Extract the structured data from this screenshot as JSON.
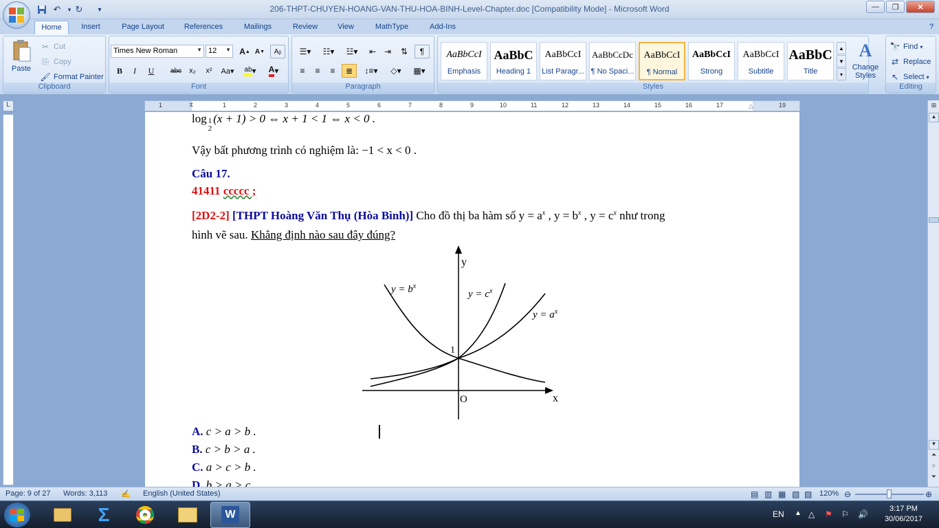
{
  "window": {
    "title": "206-THPT-CHUYEN-HOANG-VAN-THU-HOA-BINH-Level-Chapter.doc [Compatibility Mode] - Microsoft Word"
  },
  "tabs": [
    "Home",
    "Insert",
    "Page Layout",
    "References",
    "Mailings",
    "Review",
    "View",
    "MathType",
    "Add-Ins"
  ],
  "clipboard": {
    "paste": "Paste",
    "cut": "Cut",
    "copy": "Copy",
    "format_painter": "Format Painter",
    "label": "Clipboard"
  },
  "font": {
    "name": "Times New Roman",
    "size": "12",
    "label": "Font"
  },
  "paragraph": {
    "label": "Paragraph"
  },
  "styles": {
    "label": "Styles",
    "items": [
      {
        "sample": "AaBbCcI",
        "name": "Emphasis"
      },
      {
        "sample": "AaBbC",
        "name": "Heading 1"
      },
      {
        "sample": "AaBbCcI",
        "name": "List Paragr..."
      },
      {
        "sample": "AaBbCcDc",
        "name": "¶ No Spaci..."
      },
      {
        "sample": "AaBbCcI",
        "name": "¶ Normal"
      },
      {
        "sample": "AaBbCcI",
        "name": "Strong"
      },
      {
        "sample": "AaBbCcI",
        "name": "Subtitle"
      },
      {
        "sample": "AaBbC",
        "name": "Title"
      }
    ],
    "change_styles": "Change Styles"
  },
  "editing": {
    "find": "Find",
    "replace": "Replace",
    "select": "Select",
    "label": "Editing"
  },
  "ruler_numbers": [
    "1",
    "1",
    "2",
    "3",
    "4",
    "5",
    "6",
    "7",
    "8",
    "9",
    "10",
    "11",
    "12",
    "13",
    "14",
    "15",
    "16",
    "17",
    "19"
  ],
  "document": {
    "line1": "log",
    "line1_rest": "(x + 1) > 0 ⇔ x + 1 < 1 ⇔ x < 0 .",
    "line1_sub_num": "1",
    "line1_sub_den": "2",
    "line2_text": "Vậy bất phương trình có nghiệm là: ",
    "line2_math": "−1 < x < 0 .",
    "question_heading": "Câu 17.",
    "question_code": "41411",
    "question_code2": "ccccc ;",
    "q_tag": "[2D2-2]",
    "q_source": "[THPT Hoàng Văn Thụ (Hòa Bình)]",
    "q_text1": " Cho đồ thị ba hàm số  y = a",
    "q_text2": " ,  y = b",
    "q_text3": " ,  y = c",
    "q_text4": "  như trong",
    "q_line2a": "hình vẽ sau. ",
    "q_line2b": "Khẳng định nào sau đây đúng?",
    "sup_x": "x",
    "answers": [
      {
        "key": "A.",
        "text": "c > a > b ."
      },
      {
        "key": "B.",
        "text": "c > b > a ."
      },
      {
        "key": "C.",
        "text": "a > c > b ."
      },
      {
        "key": "D.",
        "text": "b > a > c"
      }
    ],
    "graph": {
      "label_y_axis": "y",
      "label_x_axis": "x",
      "label_origin": "O",
      "label_one": "1",
      "label_bx": "y = b",
      "label_cx": "y = c",
      "label_ax": "y = a",
      "sup": "x"
    }
  },
  "status": {
    "page": "Page: 9 of 27",
    "words": "Words: 3,113",
    "language": "English (United States)",
    "zoom": "120%"
  },
  "taskbar": {
    "lang": "EN",
    "time": "3:17 PM",
    "date": "30/06/2017"
  }
}
